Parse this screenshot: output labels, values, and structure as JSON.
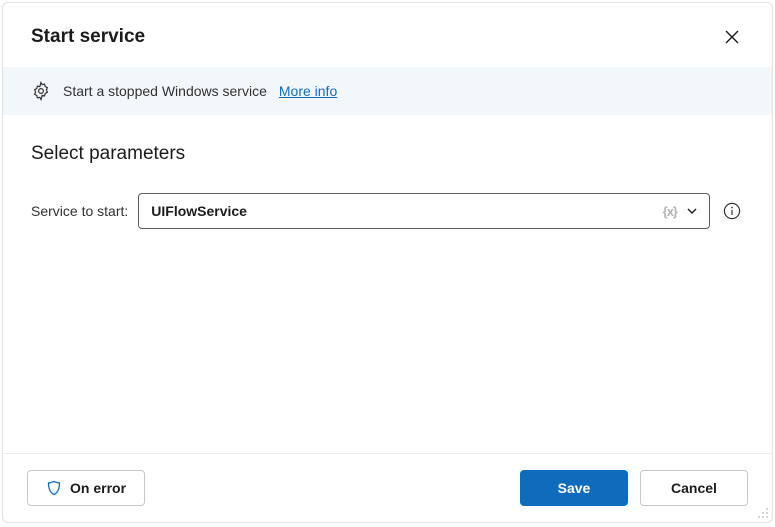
{
  "header": {
    "title": "Start service"
  },
  "info": {
    "text": "Start a stopped Windows service",
    "link_label": "More info"
  },
  "section": {
    "title": "Select parameters"
  },
  "field": {
    "label": "Service to start:",
    "value": "UIFlowService",
    "var_hint": "{x}"
  },
  "footer": {
    "on_error": "On error",
    "save": "Save",
    "cancel": "Cancel"
  }
}
